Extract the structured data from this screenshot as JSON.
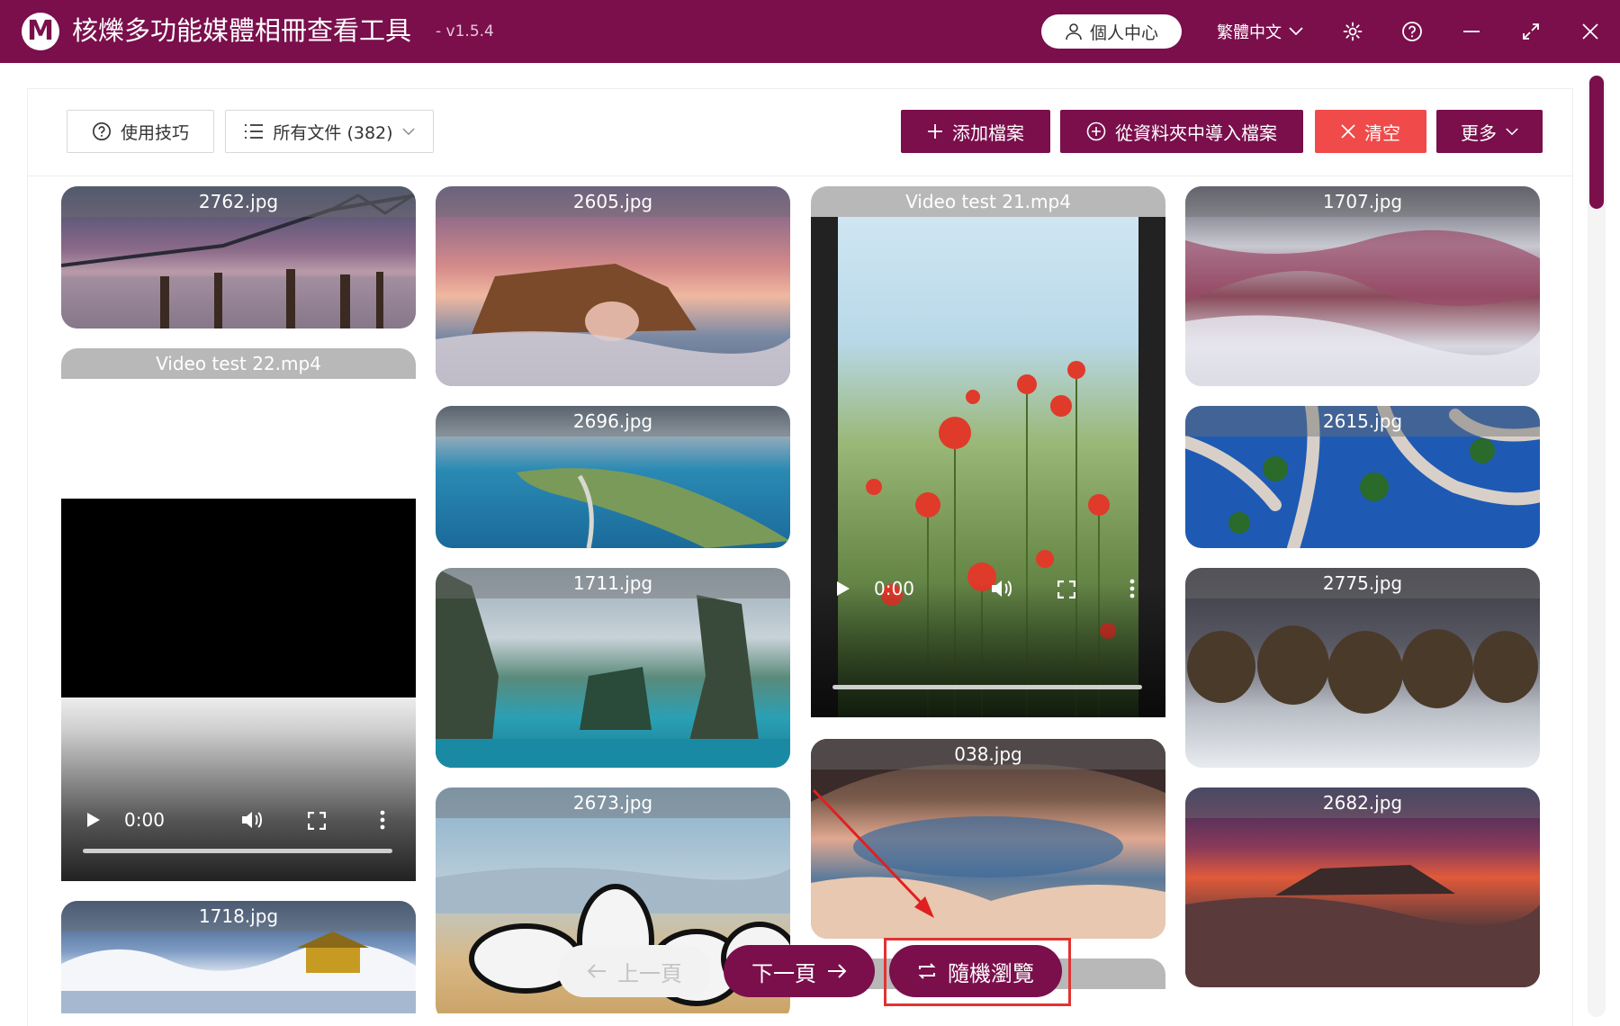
{
  "window": {
    "logo_letter": "M",
    "title": "核爍多功能媒體相冊查看工具",
    "version": "- v1.5.4",
    "user_center": "個人中心",
    "language": "繁體中文"
  },
  "toolbar": {
    "tips_label": "使用技巧",
    "filter_label": "所有文件 (382)",
    "add_label": "添加檔案",
    "import_label": "從資料夾中導入檔案",
    "clear_label": "清空",
    "more_label": "更多"
  },
  "gallery": {
    "col1": [
      {
        "name": "2762.jpg",
        "kind": "image"
      },
      {
        "name": "Video test 22.mp4",
        "kind": "video",
        "time": "0:00"
      },
      {
        "name": "1718.jpg",
        "kind": "image"
      }
    ],
    "col2": [
      {
        "name": "2605.jpg",
        "kind": "image"
      },
      {
        "name": "2696.jpg",
        "kind": "image"
      },
      {
        "name": "1711.jpg",
        "kind": "image"
      },
      {
        "name": "2673.jpg",
        "kind": "image"
      }
    ],
    "col3": [
      {
        "name": "Video test 21.mp4",
        "kind": "video",
        "time": "0:00"
      },
      {
        "name": "038.jpg",
        "kind": "image"
      }
    ],
    "col4": [
      {
        "name": "1707.jpg",
        "kind": "image"
      },
      {
        "name": "2615.jpg",
        "kind": "image"
      },
      {
        "name": "2775.jpg",
        "kind": "image"
      },
      {
        "name": "2682.jpg",
        "kind": "image"
      }
    ]
  },
  "pagination": {
    "prev_label": "上一頁",
    "next_label": "下一頁",
    "random_label": "隨機瀏覽"
  },
  "colors": {
    "brand": "#7a0f4c",
    "clear_button": "#f04a4a",
    "highlight_box": "#e23232",
    "annotation_arrow": "#e02020"
  }
}
